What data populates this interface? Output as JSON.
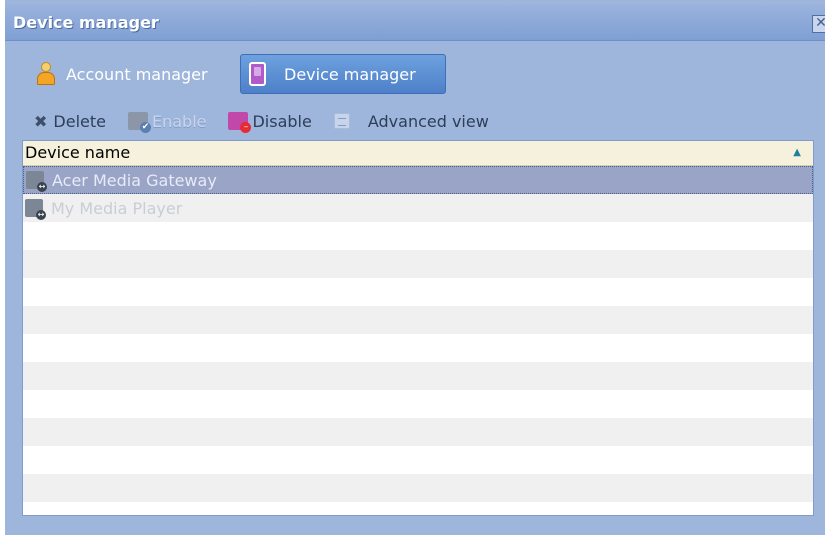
{
  "window": {
    "title": "Device manager",
    "close_label": "✕"
  },
  "tabs": [
    {
      "label": "Account manager",
      "icon": "person-icon",
      "active": false
    },
    {
      "label": "Device manager",
      "icon": "device-icon",
      "active": true
    }
  ],
  "toolbar": {
    "delete_label": "Delete",
    "enable_label": "Enable",
    "disable_label": "Disable",
    "advanced_label": "Advanced view"
  },
  "grid": {
    "column_header": "Device name",
    "sort_indicator": "▲",
    "rows": [
      {
        "name": "Acer Media Gateway",
        "selected": true
      },
      {
        "name": "My Media Player",
        "selected": false
      }
    ]
  },
  "colors": {
    "window_bg": "#9fb6dc",
    "tab_active_bg": "#5a8ad0",
    "header_bg": "#f5f1dc",
    "selected_row_bg": "#9aa4c6"
  }
}
